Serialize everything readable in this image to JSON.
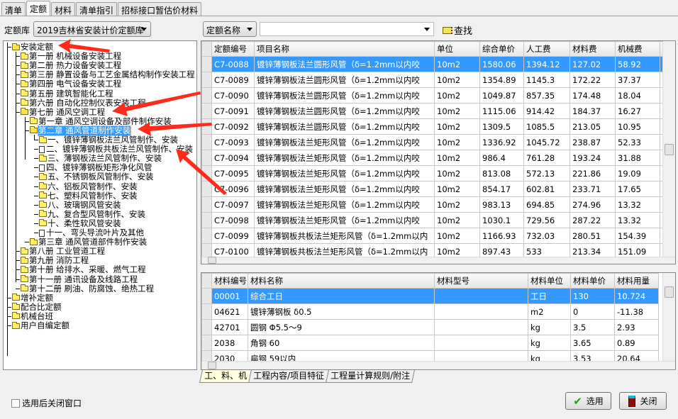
{
  "top_tabs": [
    "清单",
    "定额",
    "材料",
    "清单指引",
    "招标接口暂估价材料"
  ],
  "active_tab": 1,
  "library": {
    "label": "定额库",
    "value": "2019吉林省安装计价定额库"
  },
  "search": {
    "field_value": "定额名称",
    "query": "",
    "find_label": "查找"
  },
  "tree": [
    {
      "label": "安装定额",
      "level": 0,
      "icon": "folder-open-icon"
    },
    {
      "label": "第一册 机械设备安装工程",
      "level": 1,
      "icon": "folder-icon"
    },
    {
      "label": "第二册 热力设备安装工程",
      "level": 1,
      "icon": "folder-icon"
    },
    {
      "label": "第三册 静置设备与工艺金属结构制作安装工程",
      "level": 1,
      "icon": "folder-icon"
    },
    {
      "label": "第四册 电气设备安装工程",
      "level": 1,
      "icon": "folder-icon"
    },
    {
      "label": "第五册 建筑智能化工程",
      "level": 1,
      "icon": "folder-icon"
    },
    {
      "label": "第六册 自动化控制仪表安装工程",
      "level": 1,
      "icon": "folder-icon"
    },
    {
      "label": "第七册 通风空调工程",
      "level": 1,
      "icon": "folder-open-icon"
    },
    {
      "label": "第一章 通风空调设备及部件制作安装",
      "level": 2,
      "icon": "folder-icon"
    },
    {
      "label": "第二章 通风管道制作安装",
      "level": 2,
      "icon": "folder-open-icon",
      "selected": true
    },
    {
      "label": "一、镀锌薄钢板法兰风管制作、安装",
      "level": 3,
      "icon": "folder-icon"
    },
    {
      "label": "二、镀锌薄钢板共板法兰风管制作、安装",
      "level": 3,
      "icon": "document-icon"
    },
    {
      "label": "三、薄钢板法兰风管制作、安装",
      "level": 3,
      "icon": "folder-icon"
    },
    {
      "label": "四、镀锌薄钢板矩形净化风管",
      "level": 3,
      "icon": "document-icon"
    },
    {
      "label": "五、不锈钢板风管制作、安装",
      "level": 3,
      "icon": "folder-icon"
    },
    {
      "label": "六、铝板风管制作、安装",
      "level": 3,
      "icon": "folder-icon"
    },
    {
      "label": "七、塑料风管制作、安装",
      "level": 3,
      "icon": "folder-icon"
    },
    {
      "label": "八、玻璃钢风管安装",
      "level": 3,
      "icon": "folder-icon"
    },
    {
      "label": "九、复合型风管制作、安装",
      "level": 3,
      "icon": "folder-icon"
    },
    {
      "label": "十、柔性软风管安装",
      "level": 3,
      "icon": "folder-icon"
    },
    {
      "label": "十一、弯头导流叶片及其他",
      "level": 3,
      "icon": "document-icon"
    },
    {
      "label": "第三章 通风管道部件制作安装",
      "level": 2,
      "icon": "folder-icon"
    },
    {
      "label": "第八册 工业管道工程",
      "level": 1,
      "icon": "folder-icon"
    },
    {
      "label": "第九册 消防工程",
      "level": 1,
      "icon": "folder-icon"
    },
    {
      "label": "第十册 给排水、采暖、燃气工程",
      "level": 1,
      "icon": "folder-icon"
    },
    {
      "label": "第十一册 通讯设备及线路工程",
      "level": 1,
      "icon": "folder-icon"
    },
    {
      "label": "第十二册 刷油、防腐蚀、绝热工程",
      "level": 1,
      "icon": "folder-icon"
    },
    {
      "label": "增补定额",
      "level": 0,
      "icon": "folder-icon"
    },
    {
      "label": "配合比定额",
      "level": 0,
      "icon": "folder-icon"
    },
    {
      "label": "机械台班",
      "level": 0,
      "icon": "folder-icon"
    },
    {
      "label": "用户自编定额",
      "level": 0,
      "icon": "folder-icon"
    }
  ],
  "quota_table": {
    "columns": [
      "定额编号",
      "项目名称",
      "单位",
      "综合单价",
      "人工费",
      "材料费",
      "机械费",
      ""
    ],
    "rows": [
      [
        "C7-0088",
        "镀锌薄钢板法兰圆形风管（δ=1.2mm以内咬",
        "10m2",
        "1580.06",
        "1394.12",
        "127.02",
        "58.92"
      ],
      [
        "C7-0089",
        "镀锌薄钢板法兰圆形风管（δ=1.2mm以内咬",
        "10m2",
        "1354.89",
        "1145.3",
        "172.22",
        "37.37"
      ],
      [
        "C7-0090",
        "镀锌薄钢板法兰圆形风管（δ=1.2mm以内咬",
        "10m2",
        "1049.87",
        "857.35",
        "174.48",
        "18.04"
      ],
      [
        "C7-0091",
        "镀锌薄钢板法兰圆形风管（δ=1.2mm以内咬",
        "10m2",
        "1115.06",
        "914.42",
        "184.37",
        "16.27"
      ],
      [
        "C7-0092",
        "镀锌薄钢板法兰圆形风管（δ=1.2mm以内咬",
        "10m2",
        "1309.5",
        "1085.5",
        "213.05",
        "10.95"
      ],
      [
        "C7-0093",
        "镀锌薄钢板法兰矩形风管（δ=1.2mm以内咬",
        "10m2",
        "1336.92",
        "1045.72",
        "238.87",
        "52.33"
      ],
      [
        "C7-0094",
        "镀锌薄钢板法兰矩形风管（δ=1.2mm以内咬",
        "10m2",
        "986.4",
        "761.28",
        "193.24",
        "31.88"
      ],
      [
        "C7-0095",
        "镀锌薄钢板法兰矩形风管（δ=1.2mm以内咬",
        "10m2",
        "813.08",
        "572.13",
        "221.86",
        "19.09"
      ],
      [
        "C7-0096",
        "镀锌薄钢板法兰矩形风管（δ=1.2mm以内咬",
        "10m2",
        "854.17",
        "602.81",
        "233.71",
        "17.65"
      ],
      [
        "C7-0097",
        "镀锌薄钢板法兰矩形风管（δ=1.2mm以内咬",
        "10m2",
        "983.13",
        "694.85",
        "274.96",
        "13.32"
      ],
      [
        "C7-0098",
        "镀锌薄钢板法兰矩形风管（δ=1.2mm以内咬",
        "10m2",
        "1030.1",
        "729.56",
        "287.22",
        "13.32"
      ],
      [
        "C7-0099",
        "镀锌薄钢板共板法兰矩形风管（δ=1.2mm以内",
        "10m2",
        "1166.93",
        "732.03",
        "280.51",
        "154.39"
      ],
      [
        "C7-0100",
        "镀锌薄钢板共板法兰矩形风管（δ=1.2mm以内",
        "10m2",
        "897.43",
        "533",
        "213.34",
        "151.09"
      ]
    ]
  },
  "material_table": {
    "columns": [
      "材料编号",
      "材料名称",
      "材料型号",
      "材料单位",
      "材料单价",
      "材料用量"
    ],
    "rows": [
      [
        "00001",
        "综合工日",
        "",
        "工日",
        "130",
        "10.724"
      ],
      [
        "04621",
        "镀锌薄钢板 δ0.5",
        "",
        "m2",
        "0",
        "-11.38"
      ],
      [
        "42701",
        "圆钢 Φ5.5～9",
        "",
        "kg",
        "3.5",
        "2.93"
      ],
      [
        "2038",
        "角钢 60",
        "",
        "kg",
        "3.65",
        "0.89"
      ],
      [
        "2030",
        "扁钢 59以内",
        "",
        "kg",
        "3.53",
        "20.64"
      ]
    ]
  },
  "bottom_tabs": [
    "工、料、机",
    "工程内容/项目特征",
    "工程量计算规则/附注"
  ],
  "close_after_select": {
    "label": "选用后关闭窗口",
    "checked": false
  },
  "buttons": {
    "select": "选用",
    "close": "关闭"
  },
  "colors": {
    "selection": "#3399ff",
    "annotation_arrow": "#ff2a1a"
  }
}
